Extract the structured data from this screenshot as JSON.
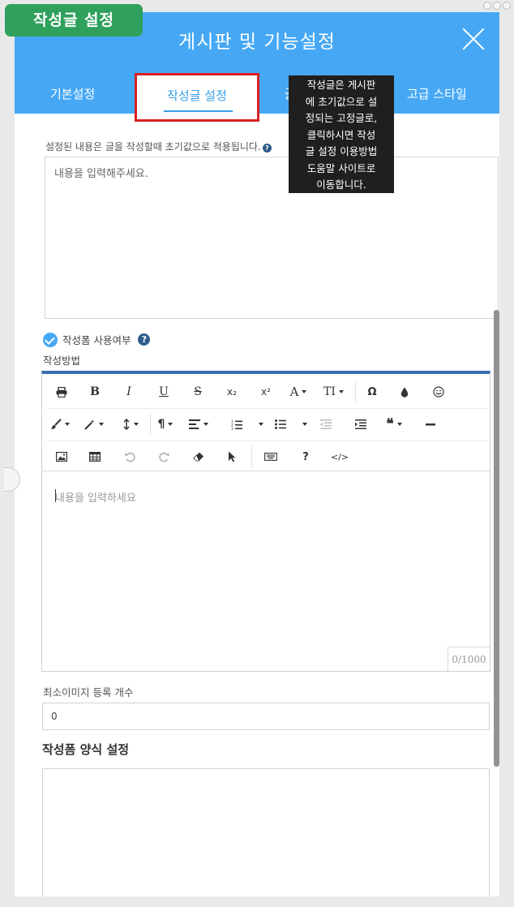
{
  "badge": {
    "label": "작성글 설정"
  },
  "header": {
    "title": "게시판 및 기능설정"
  },
  "tabs": {
    "basic": "기본설정",
    "active": "작성글 설정",
    "partial": "글",
    "style": "고급 스타일"
  },
  "tooltip": {
    "lines": [
      "작성글은 게시판",
      "에 초기값으로 설",
      "정되는 고정글로,",
      "클릭하시면 작성",
      "글 설정 이용방법",
      "도움말 사이트로",
      "이동합니다."
    ]
  },
  "description": "설정된 내용은 글을 작성할때 초기값으로 적용됩니다.",
  "content_textarea": {
    "placeholder": "내용을 입력해주세요."
  },
  "form_toggle": {
    "label": "작성폼 사용여부",
    "checked": true
  },
  "method_label": "작성방법",
  "editor": {
    "placeholder": "내용을 입력하세요",
    "counter": "0/1000",
    "toolbar": {
      "bold": "B",
      "italic": "I",
      "underline": "U",
      "strike": "S",
      "subscript": "x₂",
      "superscript": "x²",
      "font_color": "A",
      "font_size": "TI",
      "special_char": "Ω",
      "help": "?",
      "code": "</>"
    }
  },
  "min_images": {
    "label": "최소이미지 등록 개수",
    "value": "0"
  },
  "form_template": {
    "title": "작성폼 양식 설정"
  },
  "colors": {
    "header_blue": "#46a8f5",
    "badge_green": "#2fa15c",
    "highlight_red": "#d82020",
    "editor_accent": "#3c6fb0"
  }
}
